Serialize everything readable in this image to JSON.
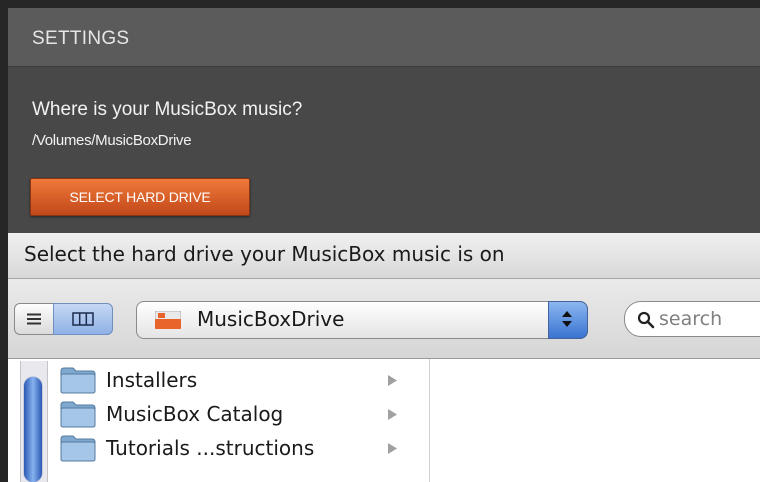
{
  "settings": {
    "title": "SETTINGS",
    "question": "Where is your MusicBox music?",
    "path": "/Volumes/MusicBoxDrive",
    "select_button": "SELECT HARD DRIVE"
  },
  "dialog": {
    "title": "Select the hard drive your MusicBox music is on",
    "toolbar": {
      "list_view_icon": "list-view-icon",
      "column_view_icon": "column-view-icon",
      "location_selected": "MusicBoxDrive",
      "search_placeholder": "search"
    },
    "items": [
      {
        "label": "Installers",
        "icon": "folder-icon"
      },
      {
        "label": "MusicBox Catalog",
        "icon": "folder-icon"
      },
      {
        "label": "Tutorials ...structions",
        "icon": "folder-icon"
      }
    ]
  },
  "colors": {
    "accent_button": "#d9591f",
    "selection_blue": "#3a73d1"
  }
}
